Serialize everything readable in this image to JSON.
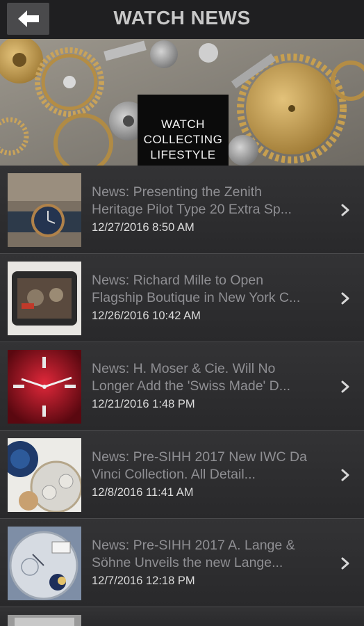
{
  "header": {
    "title": "WATCH NEWS"
  },
  "hero": {
    "logo_lines": [
      "WATCH",
      "COLLECTING",
      "LIFESTYLE"
    ]
  },
  "news": [
    {
      "line1": "News: Presenting the Zenith",
      "line2": "Heritage Pilot Type 20 Extra Sp...",
      "date": "12/27/2016 8:50 AM"
    },
    {
      "line1": "News: Richard Mille to Open",
      "line2": "Flagship Boutique in New York C...",
      "date": "12/26/2016 10:42 AM"
    },
    {
      "line1": "News: H. Moser & Cie. Will No",
      "line2": "Longer Add the 'Swiss Made' D...",
      "date": "12/21/2016 1:48 PM"
    },
    {
      "line1": "News: Pre-SIHH 2017 New IWC Da",
      "line2": "Vinci Collection. All Detail...",
      "date": "12/8/2016 11:41 AM"
    },
    {
      "line1": "News: Pre-SIHH 2017 A. Lange &",
      "line2": "Söhne Unveils the new Lange...",
      "date": "12/7/2016 12:18 PM"
    }
  ],
  "icons": {
    "back": "arrow-left-icon",
    "chevron": "chevron-right-icon"
  },
  "colors": {
    "background": "#2b2b2d",
    "header": "#1f1f21",
    "title_text": "#8f8f93",
    "date_text": "#dcdcdc"
  }
}
